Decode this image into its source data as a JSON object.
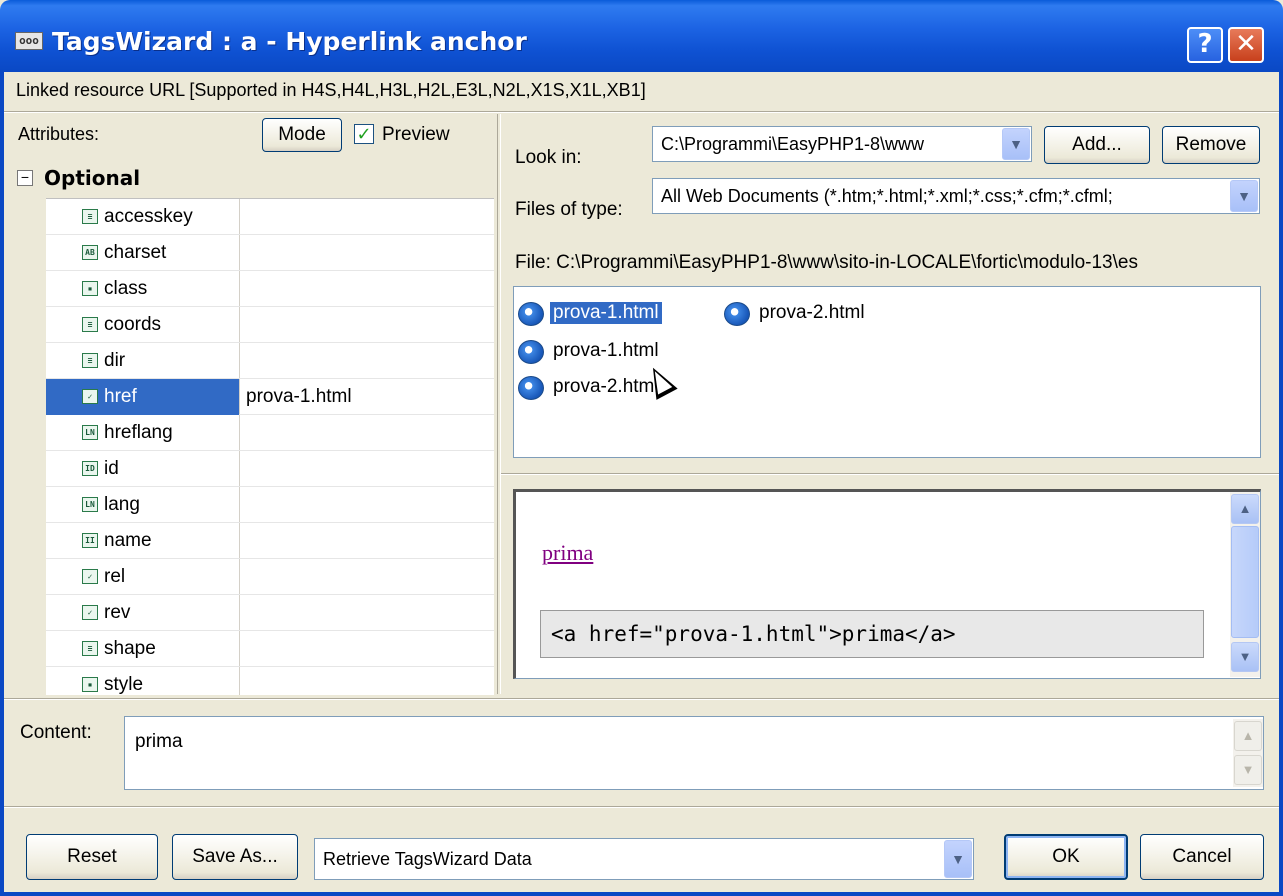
{
  "window": {
    "icon_text": "ooo",
    "title": "TagsWizard : a - Hyperlink anchor",
    "help_label": "?",
    "close_label": "✕"
  },
  "linked_resource": "Linked resource URL  [Supported in H4S,H4L,H3L,H2L,E3L,N2L,X1S,X1L,XB1]",
  "attributes_panel": {
    "label": "Attributes:",
    "mode_button": "Mode",
    "preview_checked": true,
    "preview_label": "Preview",
    "group_toggle": "⊟",
    "group_label": "Optional",
    "rows": [
      {
        "icon": "≡",
        "name": "accesskey",
        "value": ""
      },
      {
        "icon": "AB",
        "name": "charset",
        "value": ""
      },
      {
        "icon": "▪",
        "name": "class",
        "value": ""
      },
      {
        "icon": "≡",
        "name": "coords",
        "value": ""
      },
      {
        "icon": "≡",
        "name": "dir",
        "value": ""
      },
      {
        "icon": "✓",
        "name": "href",
        "value": "prova-1.html",
        "selected": true
      },
      {
        "icon": "LN",
        "name": "hreflang",
        "value": ""
      },
      {
        "icon": "ID",
        "name": "id",
        "value": ""
      },
      {
        "icon": "LN",
        "name": "lang",
        "value": ""
      },
      {
        "icon": "II",
        "name": "name",
        "value": ""
      },
      {
        "icon": "✓",
        "name": "rel",
        "value": ""
      },
      {
        "icon": "✓",
        "name": "rev",
        "value": ""
      },
      {
        "icon": "≡",
        "name": "shape",
        "value": ""
      },
      {
        "icon": "▪",
        "name": "style",
        "value": ""
      }
    ]
  },
  "browser": {
    "look_in_label": "Look in:",
    "look_in_value": "C:\\Programmi\\EasyPHP1-8\\www",
    "add_button": "Add...",
    "remove_button": "Remove",
    "files_of_type_label": "Files of type:",
    "files_of_type_value": "All Web Documents (*.htm;*.html;*.xml;*.css;*.cfm;*.cfml;",
    "file_path": "File: C:\\Programmi\\EasyPHP1-8\\www\\sito-in-LOCALE\\fortic\\modulo-13\\es",
    "files": [
      {
        "name": "prova-1.html",
        "selected": true
      },
      {
        "name": "prova-2.html",
        "selected": false
      },
      {
        "name": "prova-1.html",
        "selected": false
      },
      {
        "name": "prova-2.html",
        "selected": false
      }
    ]
  },
  "preview": {
    "link_text": "prima",
    "code": "<a href=\"prova-1.html\">prima</a>"
  },
  "content": {
    "label": "Content:",
    "value": "prima"
  },
  "footer": {
    "reset_button": "Reset",
    "save_as_button": "Save As...",
    "retrieve_value": "Retrieve TagsWizard Data",
    "ok_button": "OK",
    "cancel_button": "Cancel"
  },
  "colors": {
    "titlebar": "#0a48c4",
    "selection": "#316ac5",
    "dialog_bg": "#ece9d8",
    "visited_link": "#800080"
  },
  "icons": {
    "file": "ie-document-icon",
    "combo_arrow": "chevron-down-icon"
  }
}
